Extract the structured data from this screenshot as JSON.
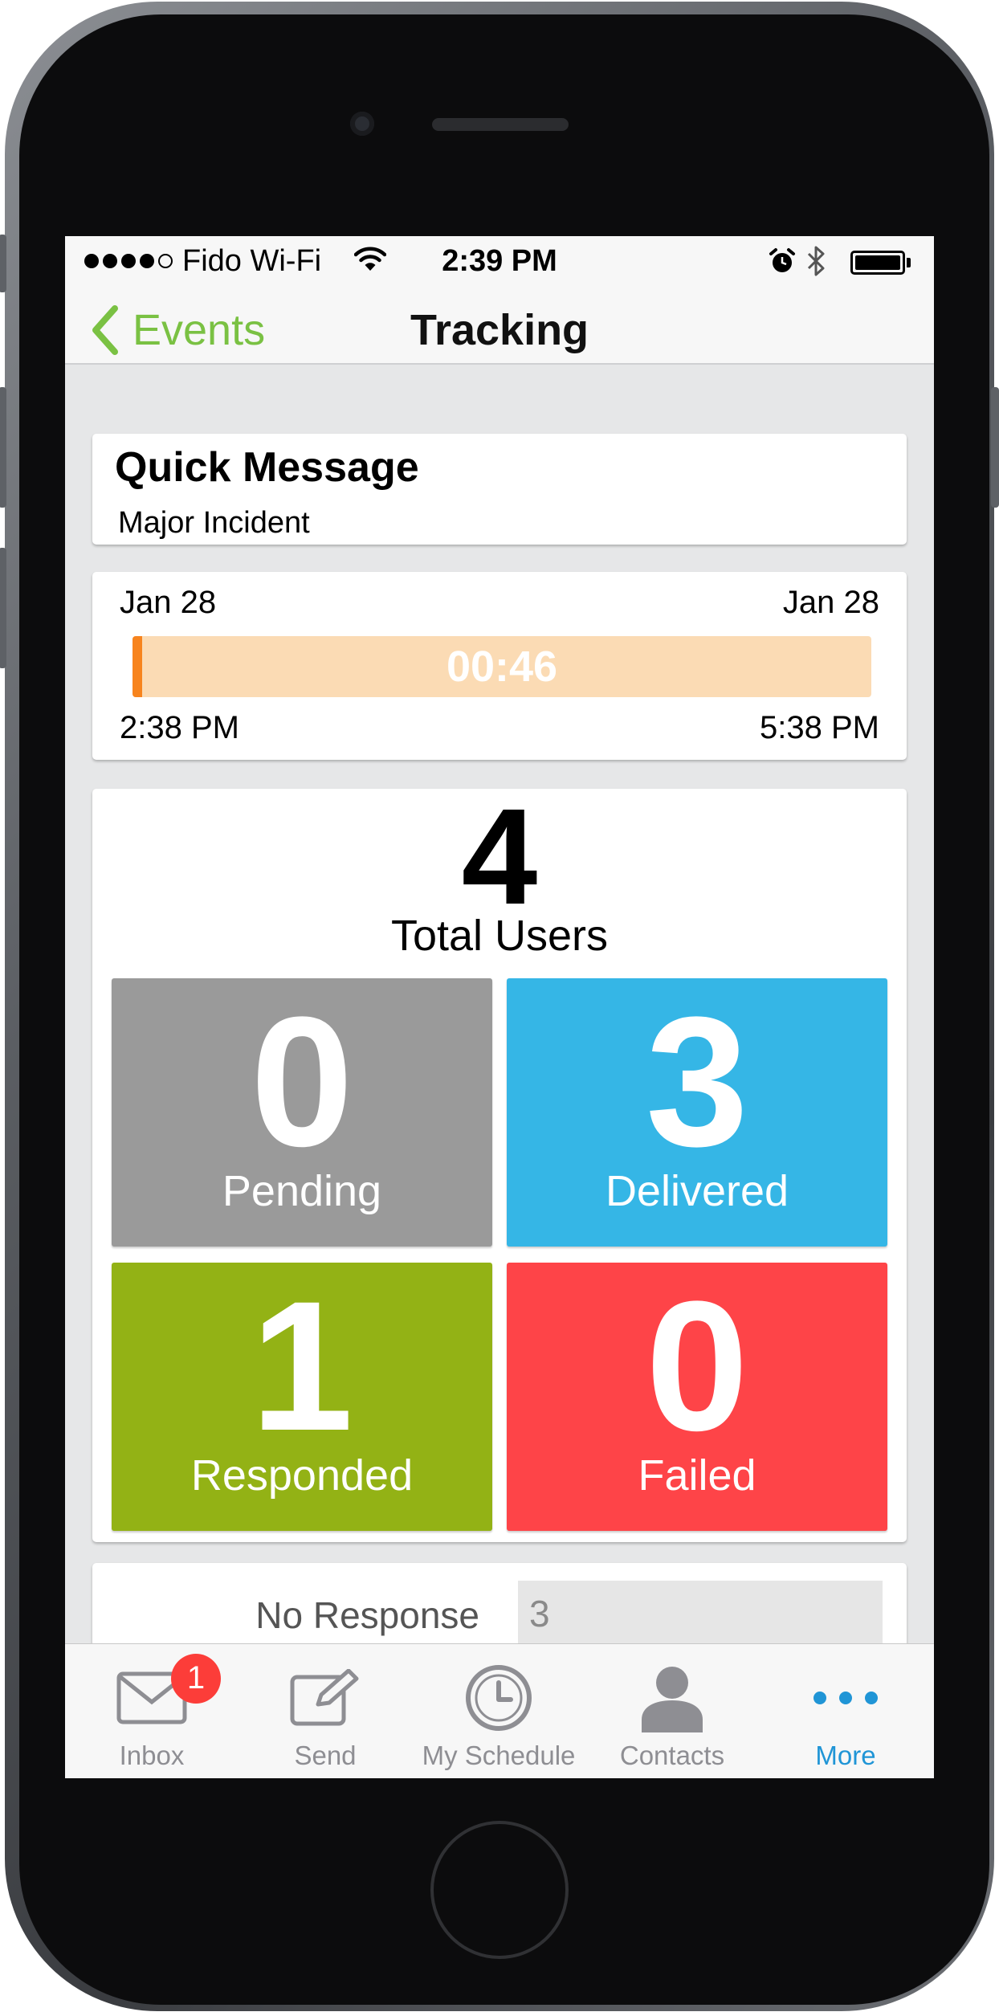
{
  "status_bar": {
    "carrier": "Fido Wi-Fi",
    "time": "2:39 PM",
    "signal_bars_filled": 4,
    "signal_bars_total": 5,
    "battery_level": 1.0
  },
  "nav": {
    "back_label": "Events",
    "title": "Tracking"
  },
  "message": {
    "title": "Quick Message",
    "subtitle": "Major Incident"
  },
  "timeline": {
    "start_date": "Jan 28",
    "end_date": "Jan 28",
    "start_time": "2:38 PM",
    "end_time": "5:38 PM",
    "elapsed": "00:46",
    "progress": 0.004
  },
  "totals": {
    "count": "4",
    "label": "Total Users"
  },
  "status_tiles": [
    {
      "count": "0",
      "label": "Pending",
      "color": "#9a9a9a"
    },
    {
      "count": "3",
      "label": "Delivered",
      "color": "#35b6e6"
    },
    {
      "count": "1",
      "label": "Responded",
      "color": "#93b215"
    },
    {
      "count": "0",
      "label": "Failed",
      "color": "#fe4448"
    }
  ],
  "responses": {
    "label": "No Response",
    "value": "3"
  },
  "tab_bar": {
    "items": [
      {
        "label": "Inbox",
        "icon": "envelope-icon",
        "badge": "1"
      },
      {
        "label": "Send",
        "icon": "compose-icon"
      },
      {
        "label": "My Schedule",
        "icon": "clock-icon"
      },
      {
        "label": "Contacts",
        "icon": "person-icon"
      },
      {
        "label": "More",
        "icon": "more-icon",
        "active": true
      }
    ],
    "active_color": "#2095d6",
    "inactive_color": "#8e8e93"
  },
  "colors": {
    "accent_green": "#7ac143",
    "timeline_track": "#fbdbb4",
    "timeline_fill": "#f7841e"
  }
}
